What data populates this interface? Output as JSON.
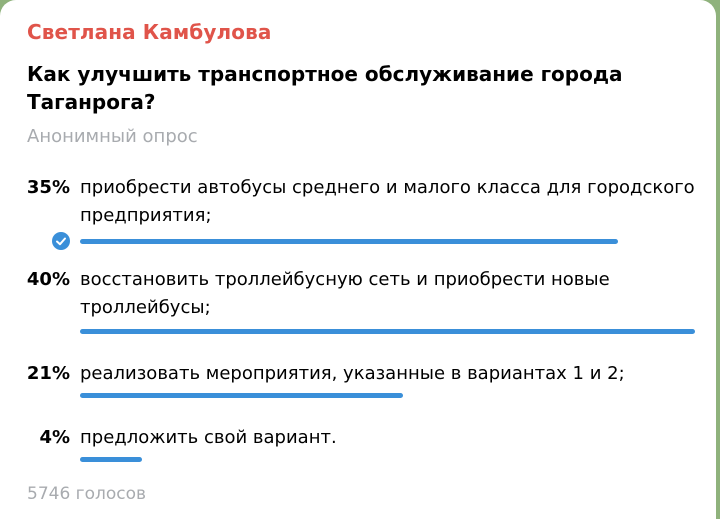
{
  "message": {
    "author": "Светлана Камбулова",
    "author_color": "#e0544a"
  },
  "poll": {
    "question": "Как улучшить транспортное обслуживание города Таганрога?",
    "type": "Анонимный опрос",
    "bar_color": "#3a8fd9",
    "options": [
      {
        "percent_label": "35%",
        "percent": 35,
        "text": "приобрести автобусы среднего и малого класса для городского предприятия;",
        "voted": true
      },
      {
        "percent_label": "40%",
        "percent": 40,
        "text": "восстановить троллейбусную сеть и приобрести новые троллейбусы;",
        "voted": false
      },
      {
        "percent_label": "21%",
        "percent": 21,
        "text": "реализовать мероприятия, указанные в вариантах 1 и 2;",
        "voted": false
      },
      {
        "percent_label": "4%",
        "percent": 4,
        "text": "предложить свой вариант.",
        "voted": false
      }
    ],
    "total_votes": "5746 голосов"
  }
}
